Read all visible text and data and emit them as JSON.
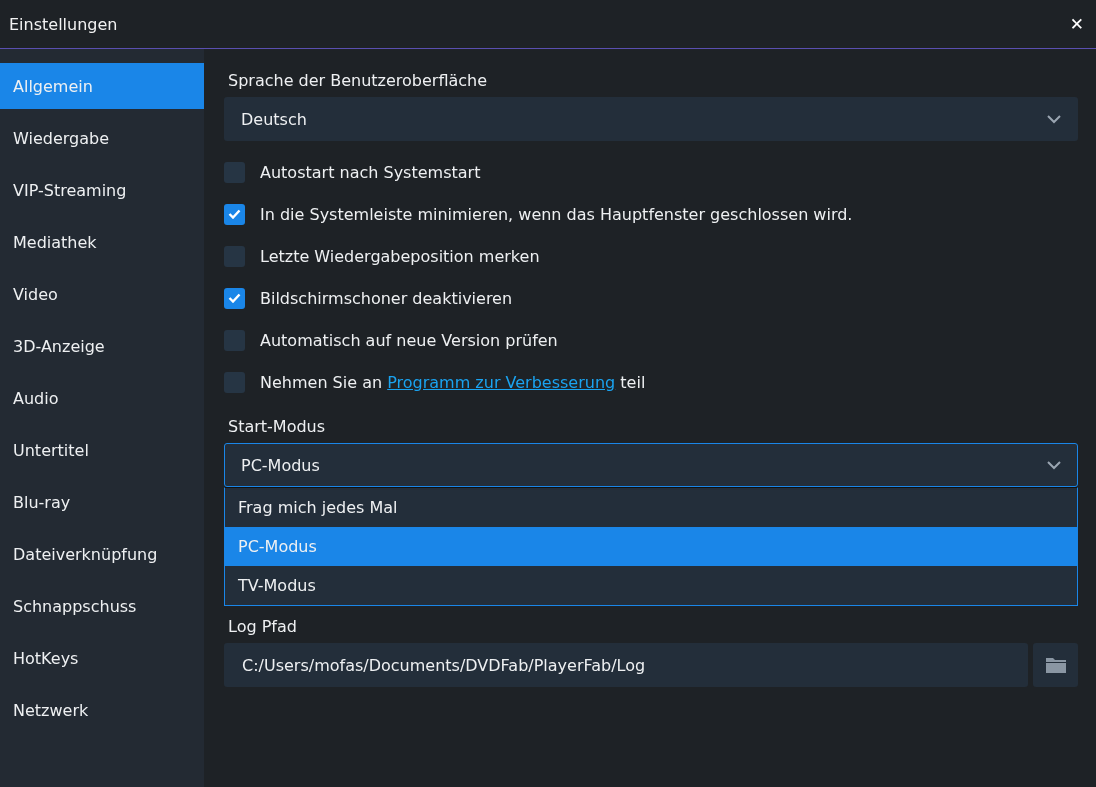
{
  "window": {
    "title": "Einstellungen",
    "close": "✕"
  },
  "sidebar": {
    "items": [
      {
        "label": "Allgemein",
        "selected": true
      },
      {
        "label": "Wiedergabe",
        "selected": false
      },
      {
        "label": "VIP-Streaming",
        "selected": false
      },
      {
        "label": "Mediathek",
        "selected": false
      },
      {
        "label": "Video",
        "selected": false
      },
      {
        "label": "3D-Anzeige",
        "selected": false
      },
      {
        "label": "Audio",
        "selected": false
      },
      {
        "label": "Untertitel",
        "selected": false
      },
      {
        "label": "Blu-ray",
        "selected": false
      },
      {
        "label": "Dateiverknüpfung",
        "selected": false
      },
      {
        "label": "Schnappschuss",
        "selected": false
      },
      {
        "label": "HotKeys",
        "selected": false
      },
      {
        "label": "Netzwerk",
        "selected": false
      }
    ]
  },
  "language": {
    "label": "Sprache der Benutzeroberfläche",
    "value": "Deutsch"
  },
  "options": [
    {
      "kind": "plain",
      "label": "Autostart nach Systemstart",
      "checked": false
    },
    {
      "kind": "plain",
      "label": "In die Systemleiste minimieren, wenn das Hauptfenster geschlossen wird.",
      "checked": true
    },
    {
      "kind": "plain",
      "label": "Letzte Wiedergabeposition merken",
      "checked": false
    },
    {
      "kind": "plain",
      "label": "Bildschirmschoner deaktivieren",
      "checked": true
    },
    {
      "kind": "plain",
      "label": "Automatisch auf neue Version prüfen",
      "checked": false
    },
    {
      "kind": "link",
      "label": "Nehmen Sie an",
      "link": "Programm zur Verbesserung",
      "suffix": "teil",
      "checked": false
    }
  ],
  "start_mode": {
    "label": "Start-Modus",
    "value": "PC-Modus",
    "expanded": true,
    "options": [
      {
        "label": "Frag mich jedes Mal",
        "selected": false
      },
      {
        "label": "PC-Modus",
        "selected": true
      },
      {
        "label": "TV-Modus",
        "selected": false
      }
    ]
  },
  "log_path": {
    "label": "Log Pfad",
    "value": "C:/Users/mofas/Documents/DVDFab/PlayerFab/Log"
  }
}
